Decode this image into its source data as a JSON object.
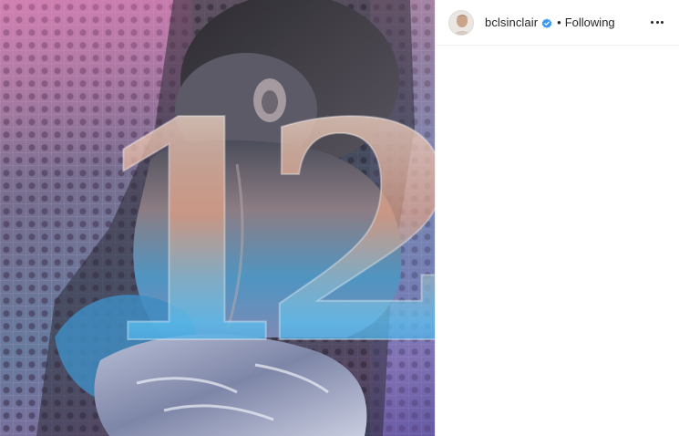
{
  "post": {
    "author": {
      "username": "bclsinclair",
      "verified": true,
      "follow_status": "Following",
      "separator": "•"
    },
    "icons": {
      "verified": "verified-badge-icon",
      "more": "more-options-icon"
    },
    "media": {
      "overlay_text": "12"
    },
    "colors": {
      "text": "#262626",
      "verified_blue": "#3897f0",
      "border": "#efefef"
    }
  }
}
